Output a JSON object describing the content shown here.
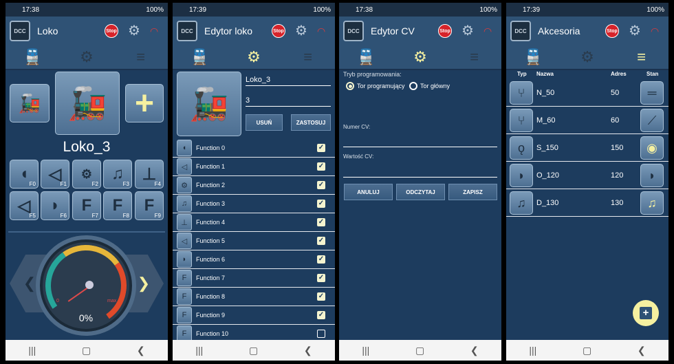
{
  "screens": [
    {
      "time": "17:38",
      "battery": "100%",
      "title": "Loko",
      "stop": "Stop",
      "loco_name": "Loko_3",
      "add": "+",
      "functions": [
        "F0",
        "F1",
        "F2",
        "F3",
        "F4",
        "F5",
        "F6",
        "F7",
        "F8",
        "F9"
      ],
      "speed": "0%",
      "gauge_min": "0",
      "gauge_max": "max"
    },
    {
      "time": "17:39",
      "battery": "100%",
      "title": "Edytor loko",
      "stop": "Stop",
      "name_value": "Loko_3",
      "address_value": "3",
      "delete": "USUŃ",
      "apply": "ZASTOSUJ",
      "functions": [
        {
          "name": "Function 0",
          "on": true
        },
        {
          "name": "Function 1",
          "on": true
        },
        {
          "name": "Function 2",
          "on": true
        },
        {
          "name": "Function 3",
          "on": true
        },
        {
          "name": "Function 4",
          "on": true
        },
        {
          "name": "Function 5",
          "on": true
        },
        {
          "name": "Function 6",
          "on": true
        },
        {
          "name": "Function 7",
          "on": true
        },
        {
          "name": "Function 8",
          "on": true
        },
        {
          "name": "Function 9",
          "on": true
        },
        {
          "name": "Function 10",
          "on": false
        }
      ]
    },
    {
      "time": "17:38",
      "battery": "100%",
      "title": "Edytor CV",
      "stop": "Stop",
      "mode_label": "Tryb programowania:",
      "opt1": "Tor programujący",
      "opt2": "Tor główny",
      "cv_label": "Numer CV:",
      "value_label": "Wartość CV:",
      "cancel": "ANULUJ",
      "read": "ODCZYTAJ",
      "write": "ZAPISZ"
    },
    {
      "time": "17:39",
      "battery": "100%",
      "title": "Akcesoria",
      "stop": "Stop",
      "col_type": "Typ",
      "col_name": "Nazwa",
      "col_addr": "Adres",
      "col_state": "Stan",
      "rows": [
        {
          "name": "N_50",
          "addr": "50"
        },
        {
          "name": "M_60",
          "addr": "60"
        },
        {
          "name": "S_150",
          "addr": "150"
        },
        {
          "name": "O_120",
          "addr": "120"
        },
        {
          "name": "D_130",
          "addr": "130"
        }
      ],
      "fab": "+"
    }
  ],
  "icons": {
    "train": "train-icon",
    "loco_edit": "loco-edit-icon",
    "track": "track-icon",
    "gear": "gear-icon",
    "wifi": "wifi-icon"
  },
  "colors": {
    "bg": "#1d3c5e",
    "bar": "#2f5275",
    "accent": "#f5f0a0",
    "stop": "#d6232a"
  }
}
